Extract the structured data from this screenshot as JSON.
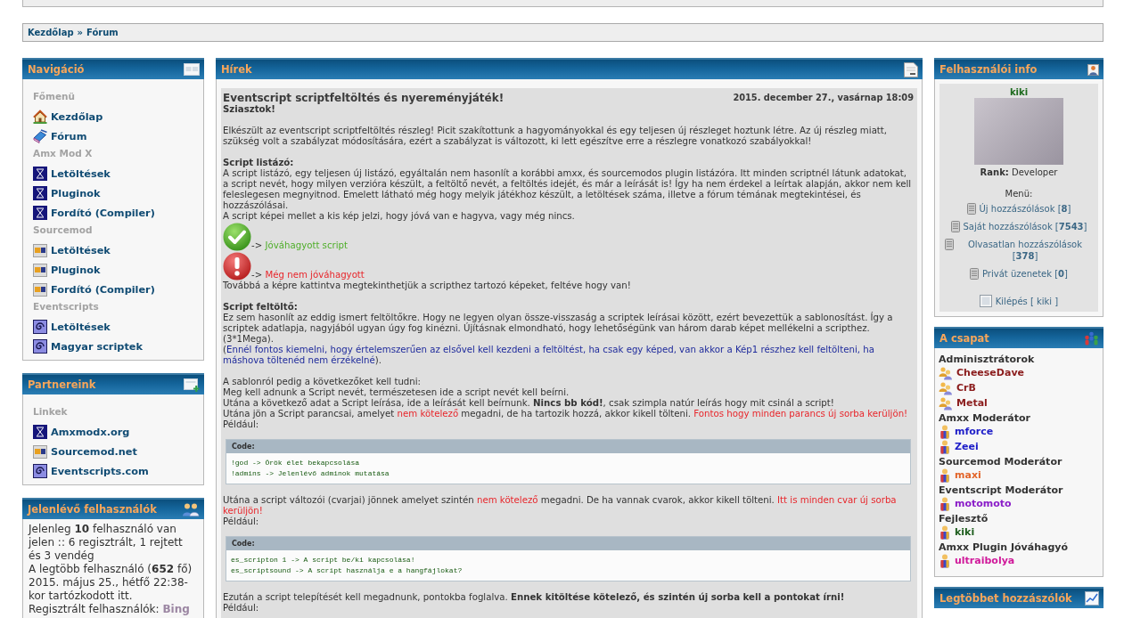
{
  "breadcrumbs": {
    "items": [
      "Kezdőlap",
      "Fórum"
    ],
    "separator": "»"
  },
  "navigation": {
    "title": "Navigáció",
    "sections": [
      {
        "label": "Főmenü",
        "items": [
          {
            "label": "Kezdőlap",
            "kind": "home"
          },
          {
            "label": "Fórum",
            "kind": "forum"
          }
        ]
      },
      {
        "label": "Amx Mod X",
        "items": [
          {
            "label": "Letöltések",
            "kind": "amx"
          },
          {
            "label": "Pluginok",
            "kind": "amx"
          },
          {
            "label": "Fordító (Compiler)",
            "kind": "amx"
          }
        ]
      },
      {
        "label": "Sourcemod",
        "items": [
          {
            "label": "Letöltések",
            "kind": "sm"
          },
          {
            "label": "Pluginok",
            "kind": "sm"
          },
          {
            "label": "Fordító (Compiler)",
            "kind": "sm"
          }
        ]
      },
      {
        "label": "Eventscripts",
        "items": [
          {
            "label": "Letöltések",
            "kind": "es"
          },
          {
            "label": "Magyar scriptek",
            "kind": "es"
          }
        ]
      }
    ]
  },
  "partners": {
    "title": "Partnereink",
    "sections": [
      {
        "label": "Linkek",
        "items": [
          {
            "label": "Amxmodx.org",
            "kind": "amx"
          },
          {
            "label": "Sourcemod.net",
            "kind": "sm"
          },
          {
            "label": "Eventscripts.com",
            "kind": "es"
          }
        ]
      }
    ]
  },
  "online": {
    "title": "Jelenlévő felhasználók",
    "lines": [
      "Jelenleg **10** felhasználó van jelen :: 6 regisztrált, 1 rejtett és 3 vendég",
      "A legtöbb felhasználó (**652** fő) 2015. május 25., hétfő 22:38-kor tartózkodott itt."
    ],
    "registered_label": "Regisztrált felhasználók:",
    "registered_users": [
      {
        "name": "Bing",
        "color": "#9c87a3"
      }
    ]
  },
  "news": {
    "title": "Hírek",
    "post": {
      "title": "Eventscript scriptfeltöltés és nyereményjáték!",
      "date": "2015. december 27., vasárnap 18:09",
      "body": [
        {
          "kind": "paragraph",
          "lines": [
            {
              "kind": "heading",
              "text": "Sziasztok!"
            }
          ]
        },
        {
          "kind": "paragraph",
          "lines": [
            {
              "kind": "text",
              "parts": [
                {
                  "text": "Elkészült az eventscript scriptfeltöltés részleg! Picit szakítottunk a hagyományokkal és egy teljesen új részleget hoztunk létre. Az új részleg miatt, szükség volt a szabályzat módosítására, ezért a szabályzat is változott, ki lett egészítve erre a részlegre vonatkozó szabályokkal!",
                  "kind": "plain"
                }
              ]
            }
          ]
        },
        {
          "kind": "paragraph",
          "lines": [
            {
              "kind": "heading",
              "text": "Script listázó:"
            },
            {
              "kind": "text",
              "parts": [
                {
                  "text": "A script listázó, egy teljesen új listázó, egyáltalán nem hasonlít a korábbi amxx, és sourcemodos plugin listázóra. Itt minden scriptnél látunk adatokat, a script nevét, hogy milyen verzióra készült, a feltöltő nevét, a feltöltés idejét, és már a leírását is! Így ha nem érdekel a leírtak alapján, akkor nem kell feleslegesen megnyitnod. Emelett látható még hogy melyik játékhoz készült, a letöltések száma, illetve a fórum témának megtekintései, és hozzászólásai.",
                  "kind": "plain"
                }
              ]
            },
            {
              "kind": "text",
              "parts": [
                {
                  "text": "A script képei mellet a kis kép jelzi, hogy jóvá van e hagyva, vagy még nincs.",
                  "kind": "plain"
                }
              ]
            },
            {
              "kind": "approved",
              "parts": [
                {
                  "text": "-> ",
                  "kind": "plain"
                },
                {
                  "text": "Jóváhagyott script",
                  "kind": "success"
                }
              ]
            },
            {
              "kind": "pending",
              "parts": [
                {
                  "text": "-> ",
                  "kind": "plain"
                },
                {
                  "text": "Még nem jóváhagyott",
                  "kind": "warning"
                }
              ]
            },
            {
              "kind": "text",
              "parts": [
                {
                  "text": "Továbbá a képre kattintva megtekinthetjük a scripthez tartozó képeket, feltéve hogy van!",
                  "kind": "plain"
                }
              ]
            }
          ]
        },
        {
          "kind": "paragraph",
          "lines": [
            {
              "kind": "heading",
              "text": "Script feltöltő:"
            },
            {
              "kind": "text",
              "parts": [
                {
                  "text": "Ez sem hasonlít az eddig ismert feltöltőkre. Hogy ne legyen olyan össze-visszaság a scriptek leírásai között, ezért bevezettük a sablonosítást. Így a scriptek adatlapja, nagyjából ugyan úgy fog kinézni. Újításnak elmondható, hogy lehetőségünk van három darab képet mellékelni a scripthez. (3*1Mega).",
                  "kind": "plain"
                }
              ]
            },
            {
              "kind": "text",
              "parts": [
                {
                  "text": "(",
                  "kind": "plain"
                },
                {
                  "text": "Ennél fontos kiemelni, hogy értelemszerűen az elsővel kell kezdeni a feltöltést, ha csak egy képed, van akkor a Kép1 részhez kell feltölteni, ha máshova töltenéd nem érzékelné",
                  "kind": "note"
                },
                {
                  "text": ").",
                  "kind": "plain"
                }
              ]
            }
          ]
        },
        {
          "kind": "paragraph",
          "lines": [
            {
              "kind": "text",
              "parts": [
                {
                  "text": "A sablonról pedig a következőket kell tudni:",
                  "kind": "plain"
                }
              ]
            },
            {
              "kind": "text",
              "parts": [
                {
                  "text": "Meg kell adnunk a Script nevét, természetesen ide a script nevét kell beírni.",
                  "kind": "plain"
                }
              ]
            },
            {
              "kind": "text",
              "parts": [
                {
                  "text": "Utána a következő adat a Script leírása, ide a leírását kell beírnunk. ",
                  "kind": "plain"
                },
                {
                  "text": "Nincs bb kód!",
                  "kind": "emphasis"
                },
                {
                  "text": ", csak szimpla natúr leírás hogy mit csinál a script!",
                  "kind": "plain"
                }
              ]
            },
            {
              "kind": "text",
              "parts": [
                {
                  "text": "Utána jön a Script parancsai, amelyet ",
                  "kind": "plain"
                },
                {
                  "text": "nem kötelező",
                  "kind": "warning"
                },
                {
                  "text": " megadni, de ha tartozik hozzá, akkor kikell tölteni. ",
                  "kind": "plain"
                },
                {
                  "text": "Fontos hogy minden parancs új sorba kerüljön!",
                  "kind": "warning"
                }
              ]
            },
            {
              "kind": "text",
              "parts": [
                {
                  "text": "Például:",
                  "kind": "plain"
                }
              ]
            }
          ]
        },
        {
          "kind": "code",
          "label": "Code:",
          "lines": [
            "!god -> Örök élet bekapcsolása",
            "!admins -> Jelenlévő adminok mutatása"
          ]
        },
        {
          "kind": "paragraph",
          "lines": [
            {
              "kind": "text",
              "parts": [
                {
                  "text": "Utána a script változói (cvarjai) jönnek amelyet szintén ",
                  "kind": "plain"
                },
                {
                  "text": "nem kötelező",
                  "kind": "warning"
                },
                {
                  "text": " megadni. De ha vannak cvarok, akkor kikell tölteni. ",
                  "kind": "plain"
                },
                {
                  "text": "Itt is minden cvar új sorba kerüljön!",
                  "kind": "warning"
                }
              ]
            },
            {
              "kind": "text",
              "parts": [
                {
                  "text": "Például:",
                  "kind": "plain"
                }
              ]
            }
          ]
        },
        {
          "kind": "code",
          "label": "Code:",
          "lines": [
            "es_scripton 1 -> A script be/ki kapcsolása!",
            "es_scriptsound -> A script használja e a hangfájlokat?"
          ]
        },
        {
          "kind": "paragraph",
          "lines": [
            {
              "kind": "text",
              "parts": [
                {
                  "text": "Ezután a script telepítését kell megadnunk, pontokba foglalva. ",
                  "kind": "plain"
                },
                {
                  "text": "Ennek kitöltése kötelező, és szintén új sorba kell a pontokat írni!",
                  "kind": "emphasis"
                }
              ]
            },
            {
              "kind": "text",
              "parts": [
                {
                  "text": "Például:",
                  "kind": "plain"
                }
              ]
            }
          ]
        }
      ]
    }
  },
  "user_info": {
    "title": "Felhasználói info",
    "username": "kiki",
    "rank": "**Rank:** Developer",
    "menu_label": "Menü:",
    "menu": [
      "Új hozzászólások [**8**]",
      "Saját hozzászólások [**7543**]",
      "Olvasatlan hozzászólások [**378**]",
      "Privát üzenetek [**0**]"
    ],
    "logout": "Kilépés [ kiki ]"
  },
  "team": {
    "title": "A csapat",
    "groups": [
      {
        "name": "Adminisztrátorok",
        "kind": "admin",
        "members": [
          {
            "name": "CheeseDave",
            "color": "#8b1c1c"
          },
          {
            "name": "CrB",
            "color": "#8b1c1c"
          },
          {
            "name": "Metal",
            "color": "#8b1c1c"
          }
        ]
      },
      {
        "name": "Amxx Moderátor",
        "kind": "moderator",
        "members": [
          {
            "name": "mforce",
            "color": "#1c1cc8"
          },
          {
            "name": "Zeei",
            "color": "#1c1cc8"
          }
        ]
      },
      {
        "name": "Sourcemod Moderátor",
        "kind": "moderator",
        "members": [
          {
            "name": "maxi",
            "color": "#e2652a"
          }
        ]
      },
      {
        "name": "Eventscript Moderátor",
        "kind": "moderator",
        "members": [
          {
            "name": "motomoto",
            "color": "#8a1cc8"
          }
        ]
      },
      {
        "name": "Fejlesztő",
        "kind": "moderator",
        "members": [
          {
            "name": "kiki",
            "color": "#1f5f1f"
          }
        ]
      },
      {
        "name": "Amxx Plugin Jóváhagyó",
        "kind": "moderator",
        "members": [
          {
            "name": "ultraibolya",
            "color": "#d0189a"
          }
        ]
      }
    ]
  },
  "top_posters": {
    "title": "Legtöbbet hozzászólók"
  }
}
